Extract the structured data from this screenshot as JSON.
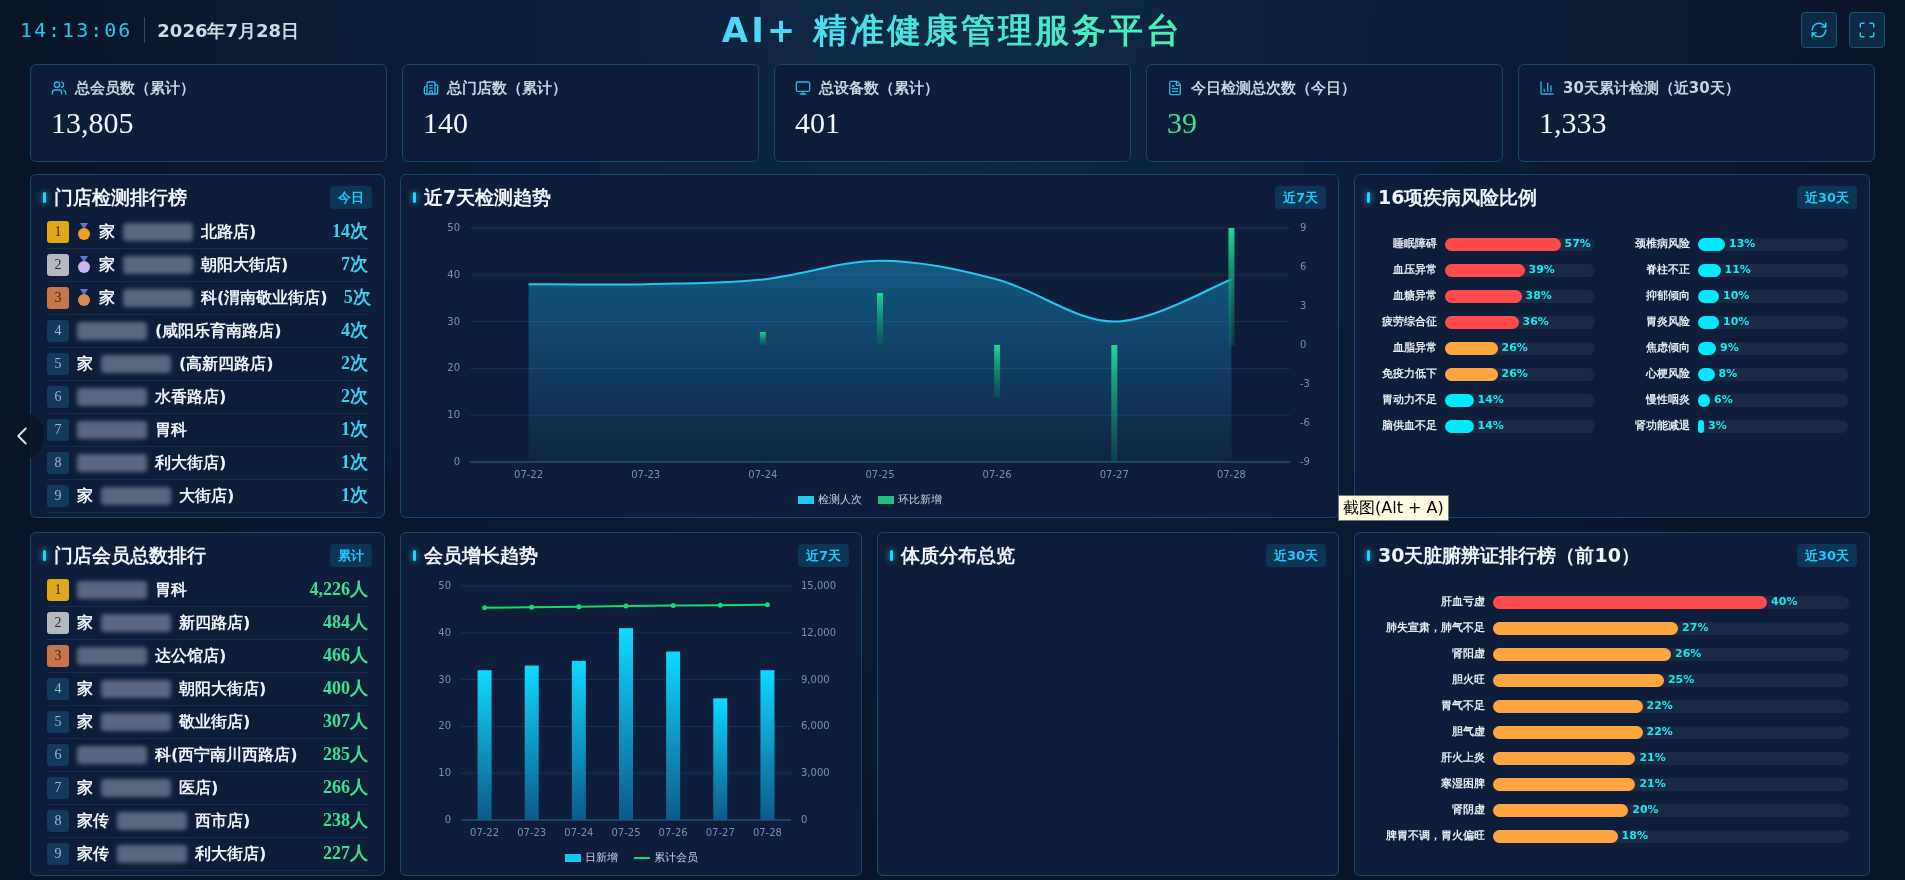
{
  "header": {
    "time": "14:13:06",
    "date": "2026年7月28日",
    "title": "AI+ 精准健康管理服务平台"
  },
  "stats": [
    {
      "label": "总会员数（累计）",
      "value": "13,805",
      "highlighted": false
    },
    {
      "label": "总门店数（累计）",
      "value": "140",
      "highlighted": false
    },
    {
      "label": "总设备数（累计）",
      "value": "401",
      "highlighted": false
    },
    {
      "label": "今日检测总次数（今日）",
      "value": "39",
      "highlighted": true
    },
    {
      "label": "30天累计检测（近30天）",
      "value": "1,333",
      "highlighted": false
    }
  ],
  "detection_ranking": {
    "title": "门店检测排行榜",
    "badge": "今日",
    "rows": [
      {
        "rank": "1",
        "medal": true,
        "prefix": "家",
        "name": "北路店)",
        "count": "14次"
      },
      {
        "rank": "2",
        "medal": true,
        "prefix": "家",
        "name": "朝阳大街店)",
        "count": "7次"
      },
      {
        "rank": "3",
        "medal": true,
        "prefix": "家",
        "name": "科(渭南敬业街店)",
        "count": "5次"
      },
      {
        "rank": "4",
        "medal": false,
        "prefix": "",
        "name": "(咸阳乐育南路店)",
        "count": "4次"
      },
      {
        "rank": "5",
        "medal": false,
        "prefix": "家",
        "name": "(高新四路店)",
        "count": "2次"
      },
      {
        "rank": "6",
        "medal": false,
        "prefix": "",
        "name": "水香路店)",
        "count": "2次"
      },
      {
        "rank": "7",
        "medal": false,
        "prefix": "",
        "name": "胃科",
        "count": "1次"
      },
      {
        "rank": "8",
        "medal": false,
        "prefix": "",
        "name": "利大街店)",
        "count": "1次"
      },
      {
        "rank": "9",
        "medal": false,
        "prefix": "家",
        "name": "大街店)",
        "count": "1次"
      }
    ]
  },
  "detection_trend": {
    "title": "近7天检测趋势",
    "badge": "近7天",
    "chart_data": {
      "type": "area",
      "grid": true,
      "categories": [
        "07-22",
        "07-23",
        "07-24",
        "07-25",
        "07-26",
        "07-27",
        "07-28"
      ],
      "series": [
        {
          "name": "检测人次",
          "color": "#22c8f0",
          "values": [
            38,
            38,
            39,
            43,
            39,
            30,
            39
          ]
        },
        {
          "name": "环比新增",
          "color": "#1fbf7f",
          "type": "bar",
          "axis": "y2",
          "values": [
            0,
            0,
            1,
            4,
            -4,
            -9,
            9
          ]
        }
      ],
      "ylim": [
        0,
        50
      ],
      "yticks": [
        0,
        10,
        20,
        30,
        40,
        50
      ],
      "y2lim": [
        -9,
        9
      ],
      "y2ticks": [
        -9,
        -6,
        -3,
        0,
        3,
        6,
        9
      ]
    }
  },
  "disease_risk": {
    "title": "16项疾病风险比例",
    "badge": "近30天",
    "items": [
      {
        "label": "睡眠障碍",
        "value": "57%",
        "level": 0.77,
        "color": "#ff4b4b"
      },
      {
        "label": "血压异常",
        "value": "39%",
        "level": 0.53,
        "color": "#ff4b4b"
      },
      {
        "label": "血糖异常",
        "value": "38%",
        "level": 0.51,
        "color": "#ff4b4b"
      },
      {
        "label": "疲劳综合征",
        "value": "36%",
        "level": 0.49,
        "color": "#ff4b4b"
      },
      {
        "label": "血脂异常",
        "value": "26%",
        "level": 0.35,
        "color": "#ffa640"
      },
      {
        "label": "免疫力低下",
        "value": "26%",
        "level": 0.35,
        "color": "#ffa640"
      },
      {
        "label": "胃动力不足",
        "value": "14%",
        "level": 0.19,
        "color": "#00eaff"
      },
      {
        "label": "脑供血不足",
        "value": "14%",
        "level": 0.19,
        "color": "#00eaff"
      },
      {
        "label": "颈椎病风险",
        "value": "13%",
        "level": 0.18,
        "color": "#00eaff"
      },
      {
        "label": "脊柱不正",
        "value": "11%",
        "level": 0.15,
        "color": "#00eaff"
      },
      {
        "label": "抑郁倾向",
        "value": "10%",
        "level": 0.14,
        "color": "#00eaff"
      },
      {
        "label": "胃炎风险",
        "value": "10%",
        "level": 0.14,
        "color": "#00eaff"
      },
      {
        "label": "焦虑倾向",
        "value": "9%",
        "level": 0.12,
        "color": "#00eaff"
      },
      {
        "label": "心梗风险",
        "value": "8%",
        "level": 0.11,
        "color": "#00eaff"
      },
      {
        "label": "慢性咽炎",
        "value": "6%",
        "level": 0.08,
        "color": "#00eaff"
      },
      {
        "label": "肾功能减退",
        "value": "3%",
        "level": 0.02,
        "color": "#00eaff"
      }
    ]
  },
  "member_ranking": {
    "title": "门店会员总数排行",
    "badge": "累计",
    "rows": [
      {
        "rank": "1",
        "prefix": "",
        "name": "胃科",
        "count": "4,226人"
      },
      {
        "rank": "2",
        "prefix": "家",
        "name": "新四路店)",
        "count": "484人"
      },
      {
        "rank": "3",
        "prefix": "",
        "name": "达公馆店)",
        "count": "466人"
      },
      {
        "rank": "4",
        "prefix": "家",
        "name": "朝阳大街店)",
        "count": "400人"
      },
      {
        "rank": "5",
        "prefix": "家",
        "name": "敬业街店)",
        "count": "307人"
      },
      {
        "rank": "6",
        "prefix": "",
        "name": "科(西宁南川西路店)",
        "count": "285人"
      },
      {
        "rank": "7",
        "prefix": "家",
        "name": "医店)",
        "count": "266人"
      },
      {
        "rank": "8",
        "prefix": "家传",
        "name": "西市店)",
        "count": "238人"
      },
      {
        "rank": "9",
        "prefix": "家传",
        "name": "利大街店)",
        "count": "227人"
      }
    ]
  },
  "member_growth": {
    "title": "会员增长趋势",
    "badge": "近7天",
    "chart_data": {
      "type": "bar",
      "grid": true,
      "categories": [
        "07-22",
        "07-23",
        "07-24",
        "07-25",
        "07-26",
        "07-27",
        "07-28"
      ],
      "series": [
        {
          "name": "日新增",
          "color": "#10c8f0",
          "values": [
            32,
            33,
            34,
            41,
            36,
            26,
            32
          ]
        },
        {
          "name": "累计会员",
          "color": "#18d870",
          "type": "line",
          "axis": "y2",
          "values": [
            13600,
            13640,
            13670,
            13710,
            13750,
            13770,
            13800
          ]
        }
      ],
      "ylim": [
        0,
        50
      ],
      "yticks": [
        0,
        10,
        20,
        30,
        40,
        50
      ],
      "y2lim": [
        0,
        15000
      ],
      "y2ticks": [
        {
          "value": 0,
          "label": "0"
        },
        {
          "value": 3000,
          "label": "3,000"
        },
        {
          "value": 6000,
          "label": "6,000"
        },
        {
          "value": 9000,
          "label": "9,000"
        },
        {
          "value": 12000,
          "label": "12,000"
        },
        {
          "value": 15000,
          "label": "15,000"
        }
      ]
    }
  },
  "constitution": {
    "title": "体质分布总览",
    "badge": "近30天"
  },
  "organ_ranking": {
    "title": "30天脏腑辨证排行榜（前10）",
    "badge": "近30天",
    "items": [
      {
        "label": "肝血亏虚",
        "value": "40%",
        "level": 0.77,
        "color": "#ff4b4b"
      },
      {
        "label": "肺失宣肃，肺气不足",
        "value": "27%",
        "level": 0.52,
        "color": "#ffa640"
      },
      {
        "label": "肾阳虚",
        "value": "26%",
        "level": 0.5,
        "color": "#ffa640"
      },
      {
        "label": "胆火旺",
        "value": "25%",
        "level": 0.48,
        "color": "#ffa640"
      },
      {
        "label": "胃气不足",
        "value": "22%",
        "level": 0.42,
        "color": "#ffa640"
      },
      {
        "label": "胆气虚",
        "value": "22%",
        "level": 0.42,
        "color": "#ffa640"
      },
      {
        "label": "肝火上炎",
        "value": "21%",
        "level": 0.4,
        "color": "#ffa640"
      },
      {
        "label": "寒湿困脾",
        "value": "21%",
        "level": 0.4,
        "color": "#ffa640"
      },
      {
        "label": "肾阴虚",
        "value": "20%",
        "level": 0.38,
        "color": "#ffa640"
      },
      {
        "label": "脾胃不调，胃火偏旺",
        "value": "18%",
        "level": 0.35,
        "color": "#ffa640"
      }
    ]
  },
  "tooltip": "截图(Alt + A)"
}
